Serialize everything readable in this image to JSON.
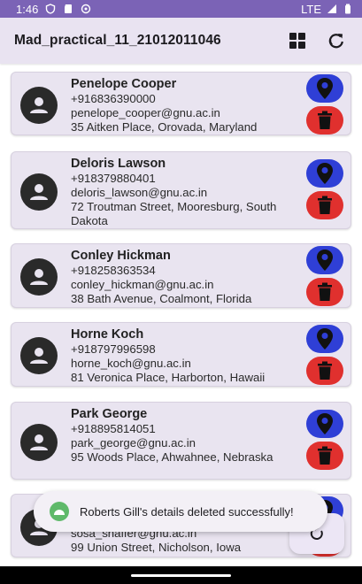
{
  "status_bar": {
    "time": "1:46",
    "network": "LTE"
  },
  "app_bar": {
    "title": "Mad_practical_11_21012011046"
  },
  "contacts": [
    {
      "name": "Penelope Cooper",
      "phone": "+916836390000",
      "email": "penelope_cooper@gnu.ac.in",
      "address": "35 Aitken Place, Orovada, Maryland"
    },
    {
      "name": "Deloris Lawson",
      "phone": "+918379880401",
      "email": "deloris_lawson@gnu.ac.in",
      "address": "72 Troutman Street, Mooresburg, South Dakota"
    },
    {
      "name": "Conley Hickman",
      "phone": "+918258363534",
      "email": "conley_hickman@gnu.ac.in",
      "address": "38 Bath Avenue, Coalmont, Florida"
    },
    {
      "name": "Horne Koch",
      "phone": "+918797996598",
      "email": "horne_koch@gnu.ac.in",
      "address": "81 Veronica Place, Harborton, Hawaii"
    },
    {
      "name": "Park George",
      "phone": "+918895814051",
      "email": "park_george@gnu.ac.in",
      "address": "95 Woods Place, Ahwahnee, Nebraska"
    },
    {
      "name": "",
      "phone": "",
      "email": "sosa_shaffer@gnu.ac.in",
      "address": "99 Union Street, Nicholson, Iowa"
    }
  ],
  "toast": {
    "message": "Roberts Gill's details deleted successfully!"
  },
  "colors": {
    "status_bar": "#7b63b6",
    "app_bar": "#e9e3f1",
    "card": "#e9e4f0",
    "location_button": "#2f3fd6",
    "delete_button": "#e0302e"
  },
  "icons": {
    "grid": "grid-icon",
    "refresh": "refresh-icon",
    "location": "location-pin-icon",
    "delete": "trash-icon",
    "avatar": "person-icon"
  }
}
